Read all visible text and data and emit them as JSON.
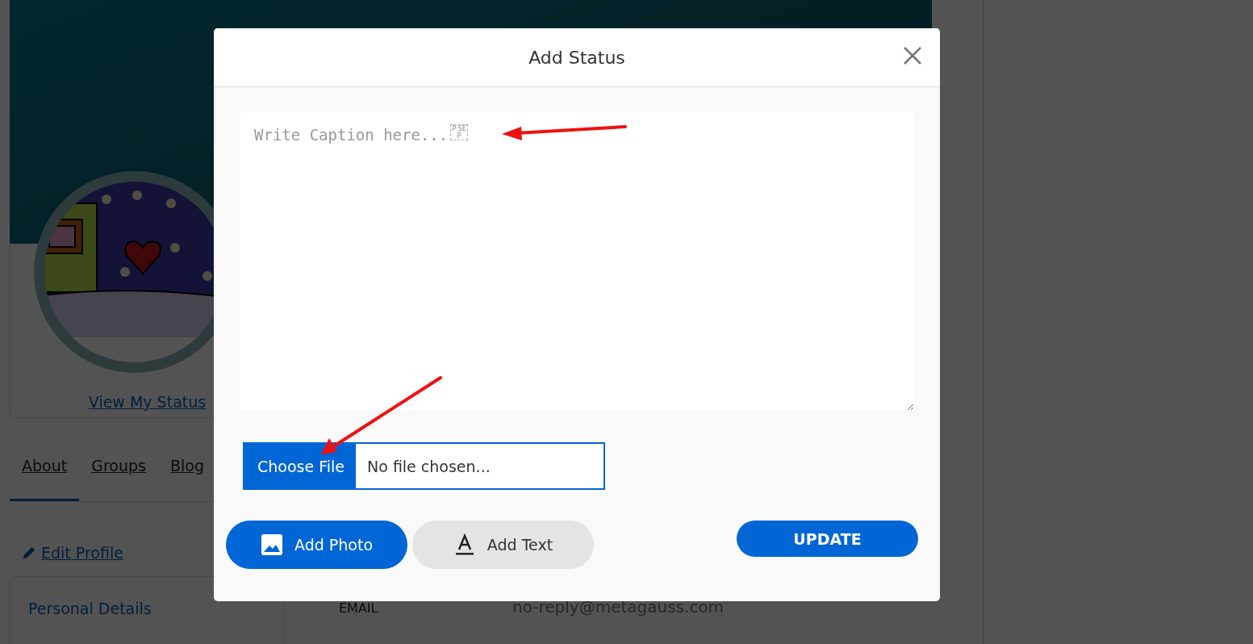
{
  "profile": {
    "view_status_link": "View My Status"
  },
  "tabs": [
    {
      "label": "About",
      "selected": true
    },
    {
      "label": "Groups",
      "selected": false
    },
    {
      "label": "Blog",
      "selected": false
    }
  ],
  "edit_profile_link": "Edit Profile",
  "personal_details": {
    "title": "Personal Details"
  },
  "fields": [
    {
      "label": "EMAIL",
      "value": "no-reply@metagauss.com"
    }
  ],
  "dialog": {
    "title": "Add Status",
    "caption": {
      "placeholder": "Write Caption here...",
      "glyph": "P SEP"
    },
    "file_input": {
      "button": "Choose File",
      "status": "No file chosen..."
    },
    "buttons": [
      {
        "label": "Add Photo",
        "kind": "photo",
        "selected": true
      },
      {
        "label": "Add Text",
        "kind": "text",
        "selected": false
      }
    ],
    "submit": "UPDATE"
  }
}
